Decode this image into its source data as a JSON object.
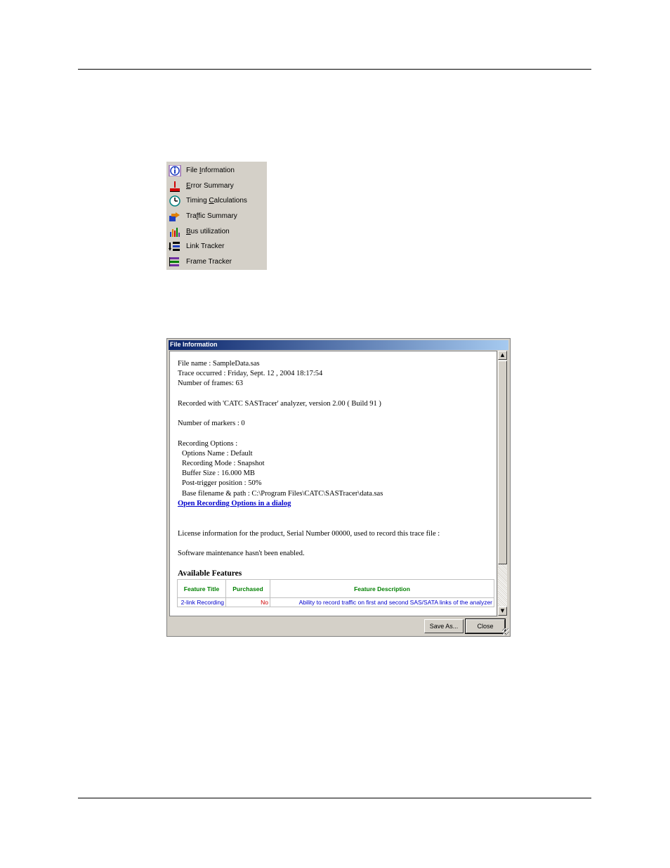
{
  "menu": {
    "items": [
      {
        "pre": "File ",
        "key": "I",
        "post": "nformation",
        "icon": "info-icon"
      },
      {
        "pre": "",
        "key": "E",
        "post": "rror Summary",
        "icon": "error-icon"
      },
      {
        "pre": "Timing ",
        "key": "C",
        "post": "alculations",
        "icon": "clock-icon"
      },
      {
        "pre": "Tra",
        "key": "f",
        "post": "fic Summary",
        "icon": "traffic-icon"
      },
      {
        "pre": "",
        "key": "B",
        "post": "us utilization",
        "icon": "bar-chart-icon"
      },
      {
        "pre": "Link Tracker",
        "key": "",
        "post": "",
        "icon": "link-tracker-icon"
      },
      {
        "pre": "Frame Tracker",
        "key": "",
        "post": "",
        "icon": "frame-tracker-icon"
      }
    ]
  },
  "dialog": {
    "title": "File Information",
    "lines": {
      "file_name": "File name : SampleData.sas",
      "trace_occurred": "Trace occurred :   Friday, Sept. 12 , 2004 18:17:54",
      "frames": "Number of frames: 63",
      "recorded_with": "Recorded with 'CATC SASTracer' analyzer, version 2.00 ( Build 91 )",
      "markers": "Number of markers : 0",
      "recording_options": "Recording Options :",
      "options_name": "Options Name : Default",
      "recording_mode": "Recording Mode : Snapshot",
      "buffer_size": "Buffer Size : 16.000 MB",
      "post_trigger": "Post-trigger position : 50%",
      "base_filename": "Base filename & path : C:\\Program Files\\CATC\\SASTracer\\data.sas",
      "open_link": "Open Recording Options in a dialog",
      "license": "License information for the product, Serial Number 00000, used to record this trace file :",
      "maintenance": "Software maintenance hasn't been enabled.",
      "available_features": "Available Features"
    },
    "table": {
      "headers": [
        "Feature Title",
        "Purchased",
        "Feature Description"
      ],
      "rows": [
        [
          "2-link Recording",
          "No",
          "Ability to record traffic on first and second SAS/SATA links of the analyzer"
        ]
      ]
    },
    "buttons": {
      "save_as": "Save As...",
      "close": "Close"
    },
    "scroll_up": "▲",
    "scroll_down": "▼"
  }
}
